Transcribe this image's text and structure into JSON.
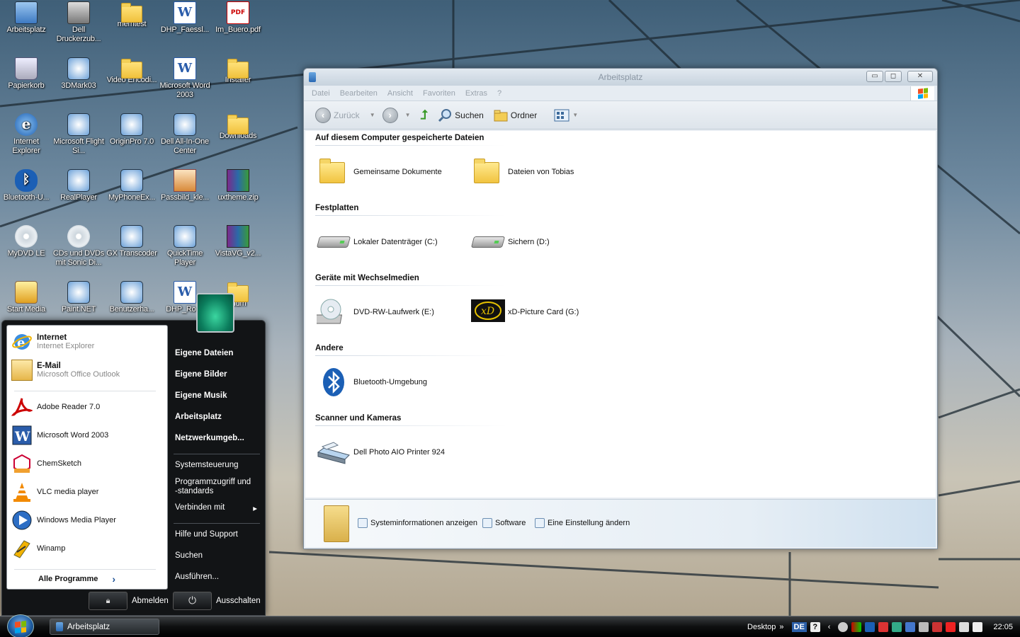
{
  "desktop": {
    "icons": [
      {
        "label": "Arbeitsplatz"
      },
      {
        "label": "Dell Druckerzub..."
      },
      {
        "label": "memtest"
      },
      {
        "label": "DHP_Faessl..."
      },
      {
        "label": "Im_Buero.pdf"
      },
      {
        "label": "Papierkorb"
      },
      {
        "label": "3DMark03"
      },
      {
        "label": "Video Encodi..."
      },
      {
        "label": "Microsoft Word 2003"
      },
      {
        "label": "Installer"
      },
      {
        "label": "Internet Explorer"
      },
      {
        "label": "Microsoft Flight Si..."
      },
      {
        "label": "OriginPro 7.0"
      },
      {
        "label": "Dell All-In-One Center"
      },
      {
        "label": "Downloads"
      },
      {
        "label": "Bluetooth-U..."
      },
      {
        "label": "RealPlayer"
      },
      {
        "label": "MyPhoneEx..."
      },
      {
        "label": "Passbild_kle..."
      },
      {
        "label": "uxtheme.zip"
      },
      {
        "label": "MyDVD LE"
      },
      {
        "label": "CDs und DVDs mit Sonic Di..."
      },
      {
        "label": "GX Transcoder"
      },
      {
        "label": "QuickTime Player"
      },
      {
        "label": "VistaVG_v2..."
      },
      {
        "label": "Start Media"
      },
      {
        "label": "Paint.NET"
      },
      {
        "label": "Benutzerha..."
      },
      {
        "label": "DHP_Roes"
      },
      {
        "label": "dium"
      }
    ]
  },
  "explorer": {
    "title": "Arbeitsplatz",
    "menu": [
      "Datei",
      "Bearbeiten",
      "Ansicht",
      "Favoriten",
      "Extras",
      "?"
    ],
    "toolbar": {
      "back": "Zurück",
      "search": "Suchen",
      "folders": "Ordner"
    },
    "sections": [
      {
        "heading": "Auf diesem Computer gespeicherte Dateien",
        "items": [
          "Gemeinsame Dokumente",
          "Dateien von Tobias"
        ]
      },
      {
        "heading": "Festplatten",
        "items": [
          "Lokaler Datenträger (C:)",
          "Sichern (D:)"
        ]
      },
      {
        "heading": "Geräte mit Wechselmedien",
        "items": [
          "DVD-RW-Laufwerk (E:)",
          "xD-Picture Card (G:)"
        ]
      },
      {
        "heading": "Andere",
        "items": [
          "Bluetooth-Umgebung"
        ]
      },
      {
        "heading": "Scanner und Kameras",
        "items": [
          "Dell Photo AIO Printer 924"
        ]
      }
    ],
    "details": {
      "sysinfo": "Systeminformationen anzeigen",
      "software": "Software",
      "setting": "Eine Einstellung ändern"
    }
  },
  "startmenu": {
    "pinned": [
      {
        "title": "Internet",
        "sub": "Internet Explorer"
      },
      {
        "title": "E-Mail",
        "sub": "Microsoft Office Outlook"
      }
    ],
    "recent": [
      "Adobe Reader 7.0",
      "Microsoft Word 2003",
      "ChemSketch",
      "VLC media player",
      "Windows Media Player",
      "Winamp"
    ],
    "all_programs": "Alle Programme",
    "right_bold": [
      "Eigene Dateien",
      "Eigene Bilder",
      "Eigene Musik",
      "Arbeitsplatz",
      "Netzwerkumgeb..."
    ],
    "right_normal": [
      "Systemsteuerung",
      "Programmzugriff und -standards",
      "Verbinden mit"
    ],
    "right_bottom": [
      "Hilfe und Support",
      "Suchen",
      "Ausführen..."
    ],
    "logoff": "Abmelden",
    "shutdown": "Ausschalten",
    "verbinden_arrow": "▸",
    "all_arrow": "›"
  },
  "taskbar": {
    "task": "Arbeitsplatz",
    "desktop_label": "Desktop",
    "chevron": "»",
    "lang": "DE",
    "clock": "22:05"
  }
}
